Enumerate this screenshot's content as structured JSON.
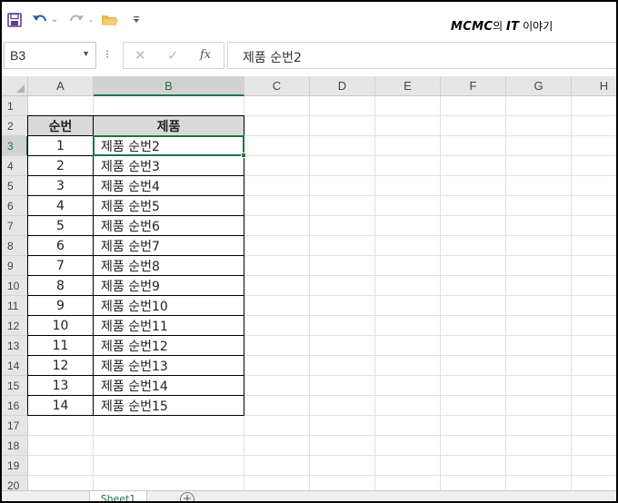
{
  "toolbar": {
    "icons": [
      "save-icon",
      "undo-icon",
      "redo-icon",
      "open-folder-icon",
      "customize-toolbar-icon"
    ],
    "brand_strong": "MCMC",
    "brand_rest": "의 IT 이야기",
    "brand_it": "IT",
    "brand_suffix": " 이야기",
    "brand_ui": "의 "
  },
  "formula_bar": {
    "name_box": "B3",
    "separator": "⁝",
    "cancel_symbol": "✕",
    "enter_symbol": "✓",
    "fx_label": "fx",
    "content": "제품 순번2"
  },
  "grid": {
    "columns": [
      "A",
      "B",
      "C",
      "D",
      "E",
      "F",
      "G",
      "H"
    ],
    "rows": [
      "1",
      "2",
      "3",
      "4",
      "5",
      "6",
      "7",
      "8",
      "9",
      "10",
      "11",
      "12",
      "13",
      "14",
      "15",
      "16",
      "17",
      "18",
      "19",
      "20"
    ],
    "selected_cell": "B3",
    "table": {
      "headers": [
        "순번",
        "제품"
      ],
      "rows": [
        [
          "1",
          "제품 순번2"
        ],
        [
          "2",
          "제품 순번3"
        ],
        [
          "3",
          "제품 순번4"
        ],
        [
          "4",
          "제품 순번5"
        ],
        [
          "5",
          "제품 순번6"
        ],
        [
          "6",
          "제품 순번7"
        ],
        [
          "7",
          "제품 순번8"
        ],
        [
          "8",
          "제품 순번9"
        ],
        [
          "9",
          "제품 순번10"
        ],
        [
          "10",
          "제품 순번11"
        ],
        [
          "11",
          "제품 순번12"
        ],
        [
          "12",
          "제품 순번13"
        ],
        [
          "13",
          "제품 순번14"
        ],
        [
          "14",
          "제품 순번15"
        ]
      ]
    }
  },
  "sheet_tabs": {
    "active": "Sheet1",
    "add_symbol": "+"
  },
  "colors": {
    "accent": "#217346",
    "undo_blue": "#1e5aa8",
    "folder_yellow": "#e8b64c",
    "save_purple": "#5a3e8c"
  }
}
